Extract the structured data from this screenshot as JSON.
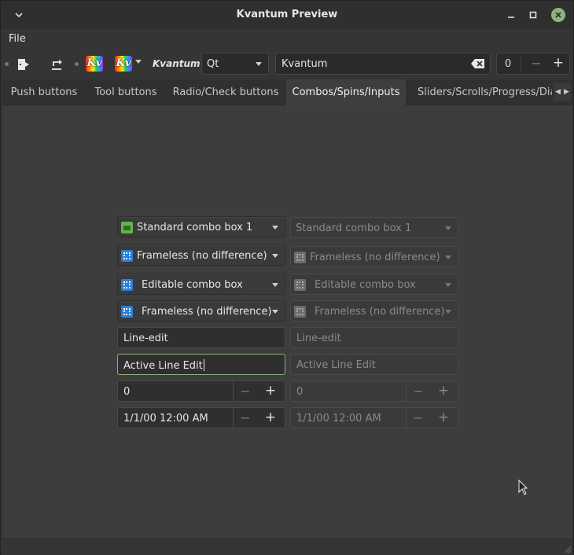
{
  "window": {
    "title": "Kvantum Preview"
  },
  "menu": {
    "file": "File"
  },
  "toolbar": {
    "kv_label": "Kv",
    "kvantum_label": "Kvantum",
    "style_combo": "Qt",
    "search_value": "Kvantum",
    "spin_value": "0",
    "spin_minus": "−",
    "spin_plus": "+"
  },
  "tabs": [
    {
      "label": "Push buttons"
    },
    {
      "label": "Tool buttons"
    },
    {
      "label": "Radio/Check buttons"
    },
    {
      "label": "Combos/Spins/Inputs",
      "active": true
    },
    {
      "label": "Sliders/Scrolls/Progress/Dial"
    }
  ],
  "controls": {
    "combo1": "Standard combo box 1",
    "combo2": "Frameless (no difference)",
    "combo3": "Editable combo box",
    "combo4": "Frameless (no difference)",
    "line_edit": "Line-edit",
    "active_edit": "Active Line Edit",
    "spin_value": "0",
    "date_value": "1/1/00 12:00 AM",
    "minus": "−",
    "plus": "+"
  },
  "colors": {
    "accent": "#8fb37a",
    "background": "#3d3d3d"
  }
}
